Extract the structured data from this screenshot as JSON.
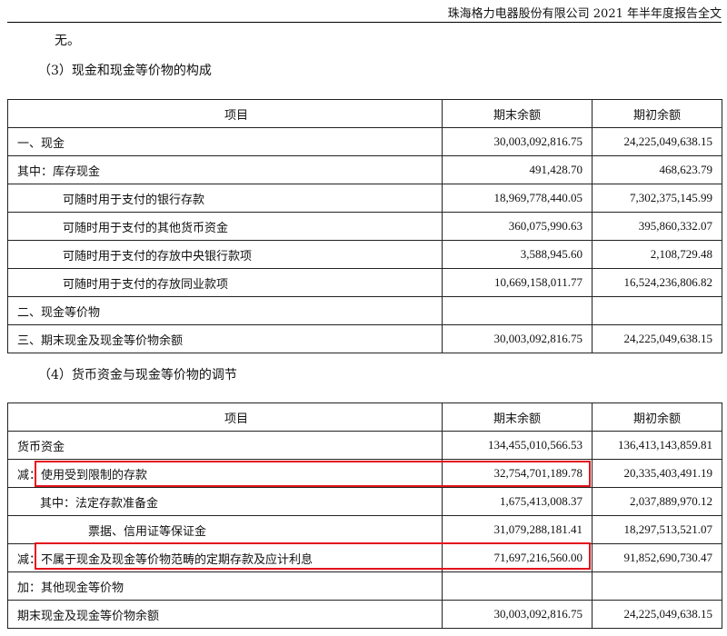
{
  "header": {
    "report_title": "珠海格力电器股份有限公司 2021 年半年度报告全文"
  },
  "intro": {
    "text": "无。"
  },
  "section3": {
    "heading": "（3）现金和现金等价物的构成",
    "columns": [
      "项目",
      "期末余额",
      "期初余额"
    ],
    "rows": [
      {
        "label": "一、现金",
        "end": "30,003,092,816.75",
        "begin": "24,225,049,638.15"
      },
      {
        "label": "其中：库存现金",
        "end": "491,428.70",
        "begin": "468,623.79"
      },
      {
        "label": "可随时用于支付的银行存款",
        "end": "18,969,778,440.05",
        "begin": "7,302,375,145.99"
      },
      {
        "label": "可随时用于支付的其他货币资金",
        "end": "360,075,990.63",
        "begin": "395,860,332.07"
      },
      {
        "label": "可随时用于支付的存放中央银行款项",
        "end": "3,588,945.60",
        "begin": "2,108,729.48"
      },
      {
        "label": "可随时用于支付的存放同业款项",
        "end": "10,669,158,011.77",
        "begin": "16,524,236,806.82"
      },
      {
        "label": "二、现金等价物",
        "end": "",
        "begin": ""
      },
      {
        "label": "三、期末现金及现金等价物余额",
        "end": "30,003,092,816.75",
        "begin": "24,225,049,638.15"
      }
    ]
  },
  "section4": {
    "heading": "（4）货币资金与现金等价物的调节",
    "columns": [
      "项目",
      "期末余额",
      "期初余额"
    ],
    "rows": [
      {
        "label": "货币资金",
        "end": "134,455,010,566.53",
        "begin": "136,413,143,859.81"
      },
      {
        "label": "减：使用受到限制的存款",
        "end": "32,754,701,189.78",
        "begin": "20,335,403,491.19"
      },
      {
        "label": "其中：法定存款准备金",
        "end": "1,675,413,008.37",
        "begin": "2,037,889,970.12"
      },
      {
        "label": "票据、信用证等保证金",
        "end": "31,079,288,181.41",
        "begin": "18,297,513,521.07"
      },
      {
        "label": "减：不属于现金及现金等价物范畴的定期存款及应计利息",
        "end": "71,697,216,560.00",
        "begin": "91,852,690,730.47"
      },
      {
        "label": "加：其他现金等价物",
        "end": "",
        "begin": ""
      },
      {
        "label": "期末现金及现金等价物余额",
        "end": "30,003,092,816.75",
        "begin": "24,225,049,638.15"
      }
    ]
  },
  "highlight_color": "#e3121b"
}
